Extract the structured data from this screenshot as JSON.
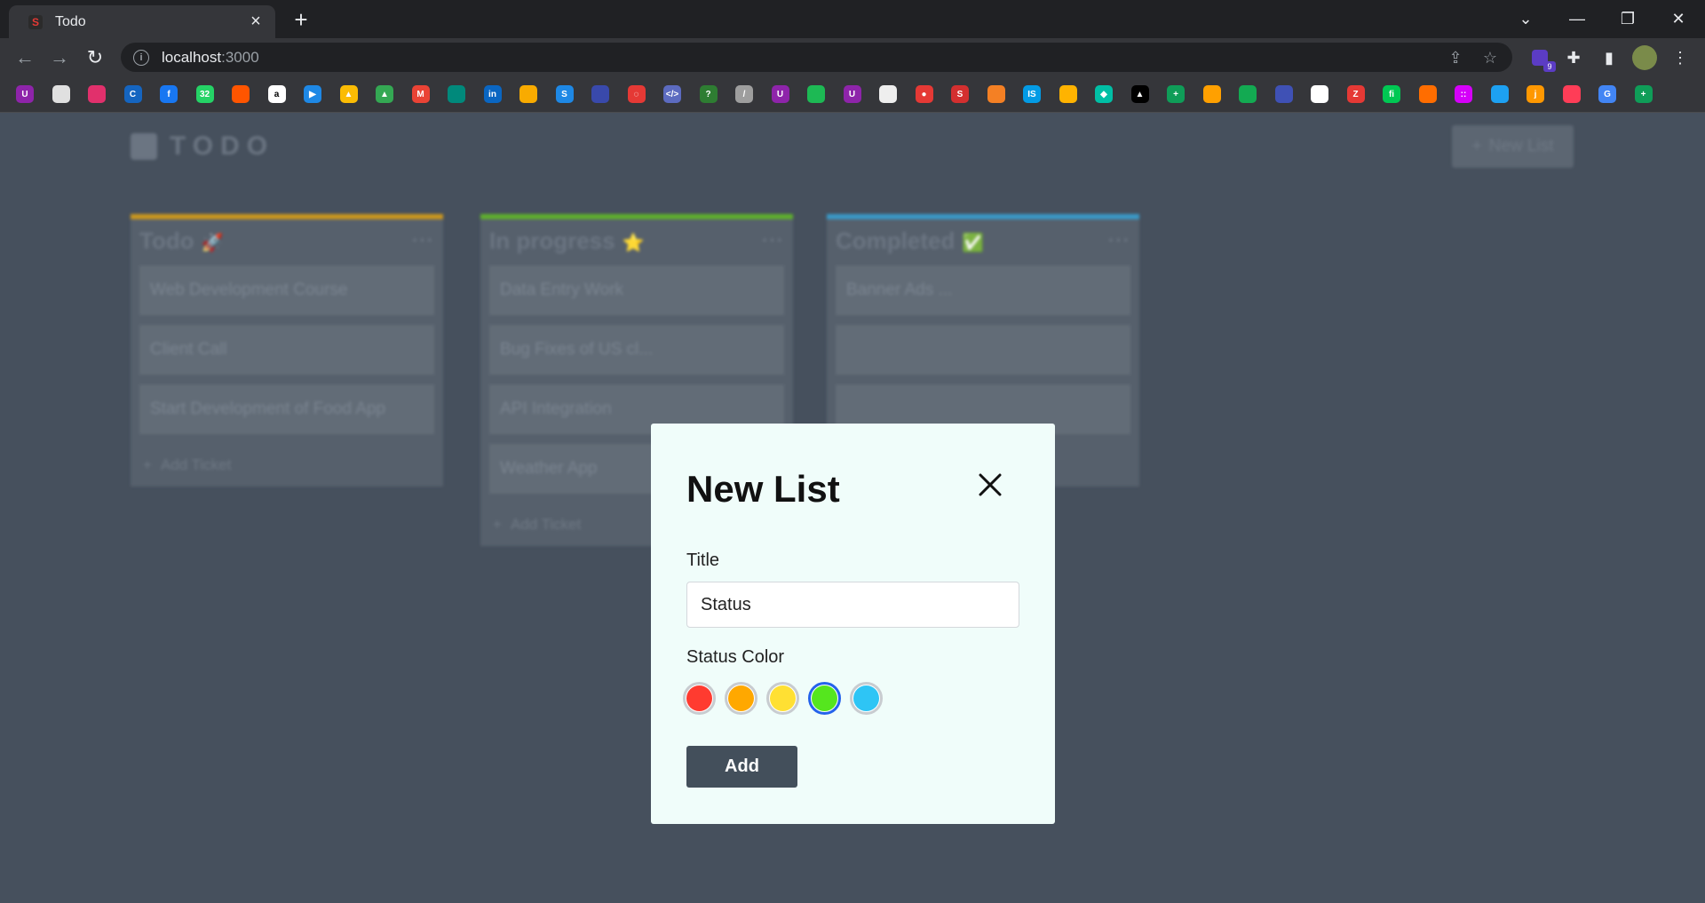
{
  "browser": {
    "tab_title": "Todo",
    "tab_favicon": "S",
    "url_host": "localhost",
    "url_port": ":3000",
    "extension_badge": "9",
    "bookmarks": [
      {
        "icon": "u-icon",
        "color": "#8e24aa",
        "glyph": "U"
      },
      {
        "icon": "image-icon",
        "color": "#e0e0e0",
        "glyph": ""
      },
      {
        "icon": "instagram-icon",
        "color": "#e1306c",
        "glyph": ""
      },
      {
        "icon": "c-icon",
        "color": "#1565c0",
        "glyph": "C"
      },
      {
        "icon": "facebook-icon",
        "color": "#1877f2",
        "glyph": "f"
      },
      {
        "icon": "whatsapp-icon",
        "color": "#25d366",
        "glyph": "32"
      },
      {
        "icon": "soundcloud-icon",
        "color": "#ff5500",
        "glyph": ""
      },
      {
        "icon": "amazon-icon",
        "color": "#ffffff",
        "glyph": "a"
      },
      {
        "icon": "play-icon",
        "color": "#1e88e5",
        "glyph": "▶"
      },
      {
        "icon": "drive-icon",
        "color": "#fbbc04",
        "glyph": "▲"
      },
      {
        "icon": "drive-icon",
        "color": "#34a853",
        "glyph": "▲"
      },
      {
        "icon": "gmail-icon",
        "color": "#ea4335",
        "glyph": "M"
      },
      {
        "icon": "meet-icon",
        "color": "#00897b",
        "glyph": ""
      },
      {
        "icon": "linkedin-icon",
        "color": "#0a66c2",
        "glyph": "in"
      },
      {
        "icon": "photos-icon",
        "color": "#f9ab00",
        "glyph": ""
      },
      {
        "icon": "s-icon",
        "color": "#1e88e5",
        "glyph": "S"
      },
      {
        "icon": "generic-icon",
        "color": "#3949ab",
        "glyph": ""
      },
      {
        "icon": "circle-icon",
        "color": "#e53935",
        "glyph": "◌"
      },
      {
        "icon": "code-icon",
        "color": "#5c6bc0",
        "glyph": "</>"
      },
      {
        "icon": "help-icon",
        "color": "#2e7d32",
        "glyph": "?"
      },
      {
        "icon": "feather-icon",
        "color": "#9e9e9e",
        "glyph": "/"
      },
      {
        "icon": "u-icon",
        "color": "#8e24aa",
        "glyph": "U"
      },
      {
        "icon": "spotify-icon",
        "color": "#1db954",
        "glyph": ""
      },
      {
        "icon": "u-icon",
        "color": "#8e24aa",
        "glyph": "U"
      },
      {
        "icon": "doc-icon",
        "color": "#eeeeee",
        "glyph": ""
      },
      {
        "icon": "dot-icon",
        "color": "#e53935",
        "glyph": "●"
      },
      {
        "icon": "s-icon",
        "color": "#d32f2f",
        "glyph": "S"
      },
      {
        "icon": "stack-icon",
        "color": "#f48024",
        "glyph": ""
      },
      {
        "icon": "is-icon",
        "color": "#039be5",
        "glyph": "IS"
      },
      {
        "icon": "bug-icon",
        "color": "#ffb300",
        "glyph": ""
      },
      {
        "icon": "diamond-icon",
        "color": "#00bfa5",
        "glyph": "◆"
      },
      {
        "icon": "triangle-icon",
        "color": "#000000",
        "glyph": "▲"
      },
      {
        "icon": "sheets-icon",
        "color": "#0f9d58",
        "glyph": "+"
      },
      {
        "icon": "firebase-icon",
        "color": "#ffa000",
        "glyph": ""
      },
      {
        "icon": "mongodb-icon",
        "color": "#13aa52",
        "glyph": ""
      },
      {
        "icon": "wave-icon",
        "color": "#3f51b5",
        "glyph": ""
      },
      {
        "icon": "chat-icon",
        "color": "#ffffff",
        "glyph": ""
      },
      {
        "icon": "z-icon",
        "color": "#e53935",
        "glyph": "Z"
      },
      {
        "icon": "fi-icon",
        "color": "#00c853",
        "glyph": "fi"
      },
      {
        "icon": "orbit-icon",
        "color": "#ff6d00",
        "glyph": ""
      },
      {
        "icon": "dots-icon",
        "color": "#d500f9",
        "glyph": "::"
      },
      {
        "icon": "twitter-icon",
        "color": "#1da1f2",
        "glyph": ""
      },
      {
        "icon": "j-icon",
        "color": "#ff9800",
        "glyph": "j"
      },
      {
        "icon": "monday-icon",
        "color": "#ff3d57",
        "glyph": ""
      },
      {
        "icon": "g-icon",
        "color": "#4285f4",
        "glyph": "G"
      },
      {
        "icon": "add-icon",
        "color": "#0f9d58",
        "glyph": "+"
      }
    ]
  },
  "app": {
    "logo_text": "TODO",
    "new_list_label": "New List",
    "columns": [
      {
        "title": "Todo",
        "emoji": "🚀",
        "accent": "#c9961f",
        "tickets": [
          "Web Development Course",
          "Client Call",
          "Start Development of Food App"
        ],
        "add_label": "Add Ticket"
      },
      {
        "title": "In progress",
        "emoji": "⭐",
        "accent": "#5fae2e",
        "tickets": [
          "Data Entry Work",
          "Bug Fixes of US cl...",
          "API Integration",
          "Weather App"
        ],
        "add_label": "Add Ticket"
      },
      {
        "title": "Completed",
        "emoji": "✅",
        "accent": "#3a98c6",
        "tickets": [
          "Banner Ads ...",
          "",
          ""
        ],
        "add_label": ""
      }
    ]
  },
  "modal": {
    "title": "New List",
    "title_label": "Title",
    "title_value": "Status",
    "color_label": "Status Color",
    "colors": [
      "#ff3b30",
      "#ffa800",
      "#ffe033",
      "#55e61e",
      "#2ec5f5"
    ],
    "selected_color_index": 3,
    "add_label": "Add"
  }
}
